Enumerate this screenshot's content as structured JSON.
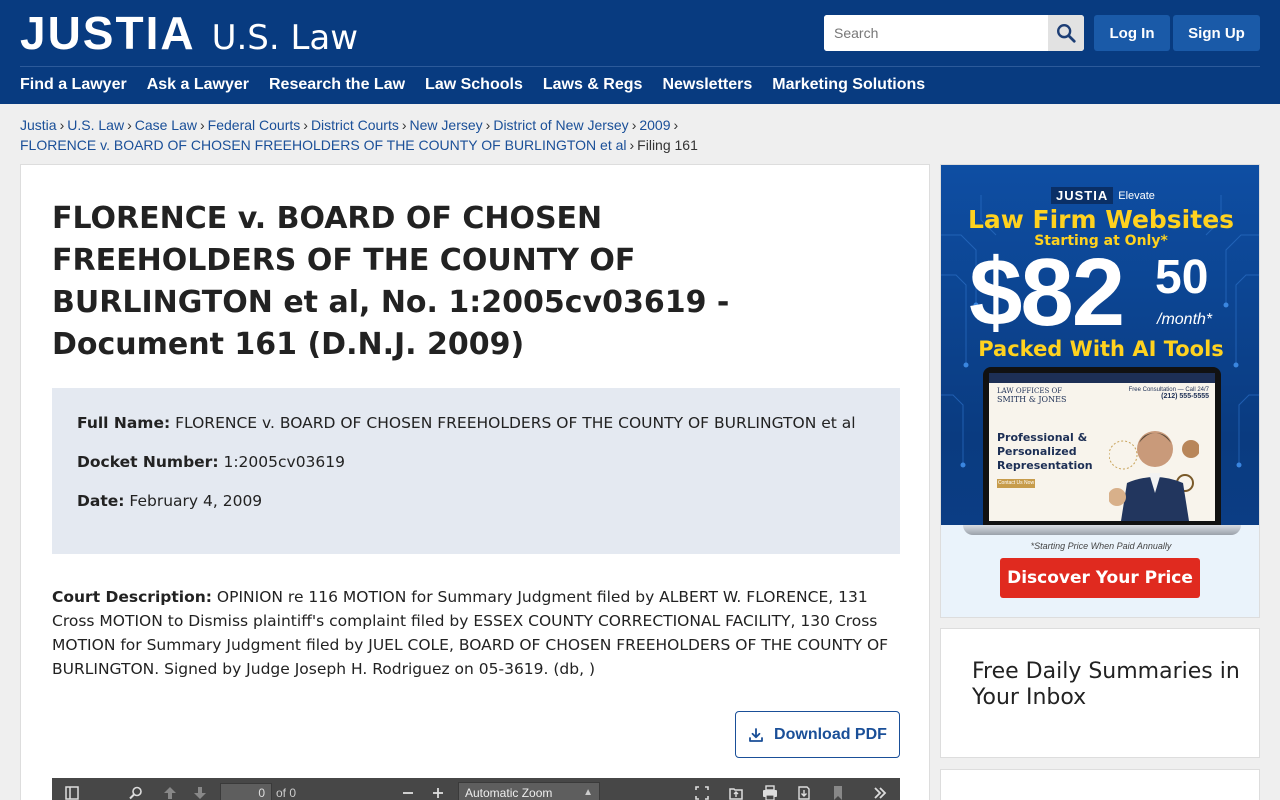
{
  "header": {
    "logo_main": "JUSTIA",
    "logo_sub": "U.S. Law",
    "search_placeholder": "Search",
    "login_label": "Log In",
    "signup_label": "Sign Up",
    "nav": [
      "Find a Lawyer",
      "Ask a Lawyer",
      "Research the Law",
      "Law Schools",
      "Laws & Regs",
      "Newsletters",
      "Marketing Solutions"
    ]
  },
  "breadcrumb": {
    "items": [
      "Justia",
      "U.S. Law",
      "Case Law",
      "Federal Courts",
      "District Courts",
      "New Jersey",
      "District of New Jersey",
      "2009",
      "FLORENCE v. BOARD OF CHOSEN FREEHOLDERS OF THE COUNTY OF BURLINGTON et al"
    ],
    "separator": "›",
    "current": "Filing 161"
  },
  "main": {
    "title": "FLORENCE v. BOARD OF CHOSEN FREEHOLDERS OF THE COUNTY OF BURLINGTON et al, No. 1:2005cv03619 - Document 161 (D.N.J. 2009)",
    "full_name_label": "Full Name:",
    "full_name": "FLORENCE v. BOARD OF CHOSEN FREEHOLDERS OF THE COUNTY OF BURLINGTON et al",
    "docket_label": "Docket Number:",
    "docket": "1:2005cv03619",
    "date_label": "Date:",
    "date": "February 4, 2009",
    "desc_label": "Court Description:",
    "desc": "OPINION re 116 MOTION for Summary Judgment filed by ALBERT W. FLORENCE, 131 Cross MOTION to Dismiss plaintiff's complaint filed by ESSEX COUNTY CORRECTIONAL FACILITY, 130 Cross MOTION for Summary Judgment filed by JUEL COLE, BOARD OF CHOSEN FREEHOLDERS OF THE COUNTY OF BURLINGTON. Signed by Judge Joseph H. Rodriguez on 05-3619. (db, )",
    "download_label": "Download PDF"
  },
  "pdf_toolbar": {
    "page_value": "0",
    "page_of": "of 0",
    "zoom": "Automatic Zoom"
  },
  "ad": {
    "logo": "JUSTIA",
    "logo_sub": "Elevate",
    "headline": "Law Firm Websites",
    "sub": "Starting at Only*",
    "price_dollar": "$82",
    "price_cents": "50",
    "per": "/month*",
    "tagline": "Packed With AI Tools",
    "screen_firm_small": "LAW OFFICES OF",
    "screen_firm": "SMITH & JONES",
    "screen_phone_label": "Free Consultation — Call 24/7",
    "screen_phone": "(212) 555-5555",
    "screen_headline": "Professional & Personalized Representation",
    "screen_btn": "Contact Us Now",
    "note": "*Starting Price When Paid Annually",
    "cta": "Discover Your Price"
  },
  "newsletter": {
    "title": "Free Daily Summaries in Your Inbox"
  }
}
